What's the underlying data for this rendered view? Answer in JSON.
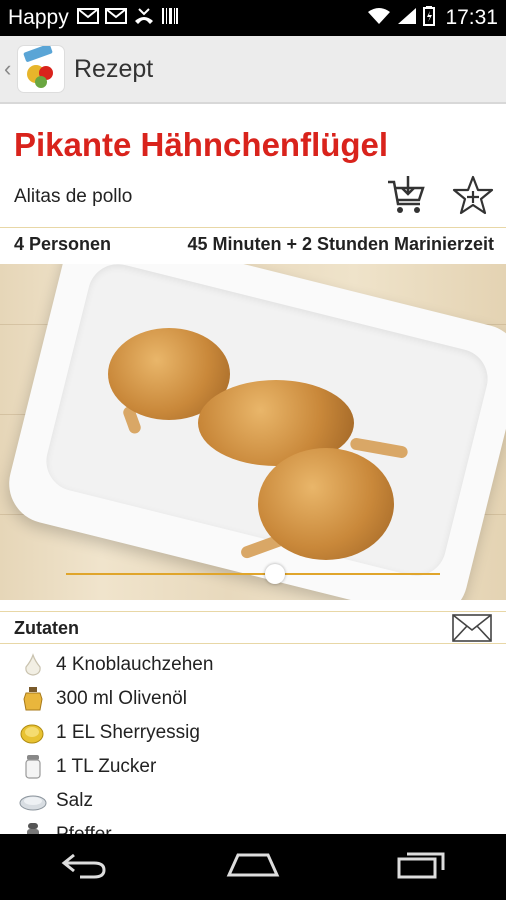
{
  "status_bar": {
    "carrier": "Happy",
    "time": "17:31"
  },
  "action_bar": {
    "title": "Rezept"
  },
  "recipe": {
    "title": "Pikante Hähnchenflügel",
    "subtitle": "Alitas de pollo",
    "servings": "4 Personen",
    "duration": "45 Minuten + 2 Stunden Marinierzeit"
  },
  "photo": {
    "slide_position": 0.56
  },
  "ingredients_section": {
    "heading": "Zutaten",
    "items": [
      {
        "label": "4  Knoblauchzehen",
        "icon": "garlic-icon"
      },
      {
        "label": "300 ml Olivenöl",
        "icon": "oil-jar-icon"
      },
      {
        "label": "1 EL Sherryessig",
        "icon": "vinegar-icon"
      },
      {
        "label": "1 TL Zucker",
        "icon": "sugar-shaker-icon"
      },
      {
        "label": "Salz",
        "icon": "salt-icon"
      },
      {
        "label": "Pfeffer",
        "icon": "pepper-icon"
      }
    ]
  },
  "colors": {
    "title_red": "#d9231c",
    "accent_gold": "#e0a52b"
  }
}
